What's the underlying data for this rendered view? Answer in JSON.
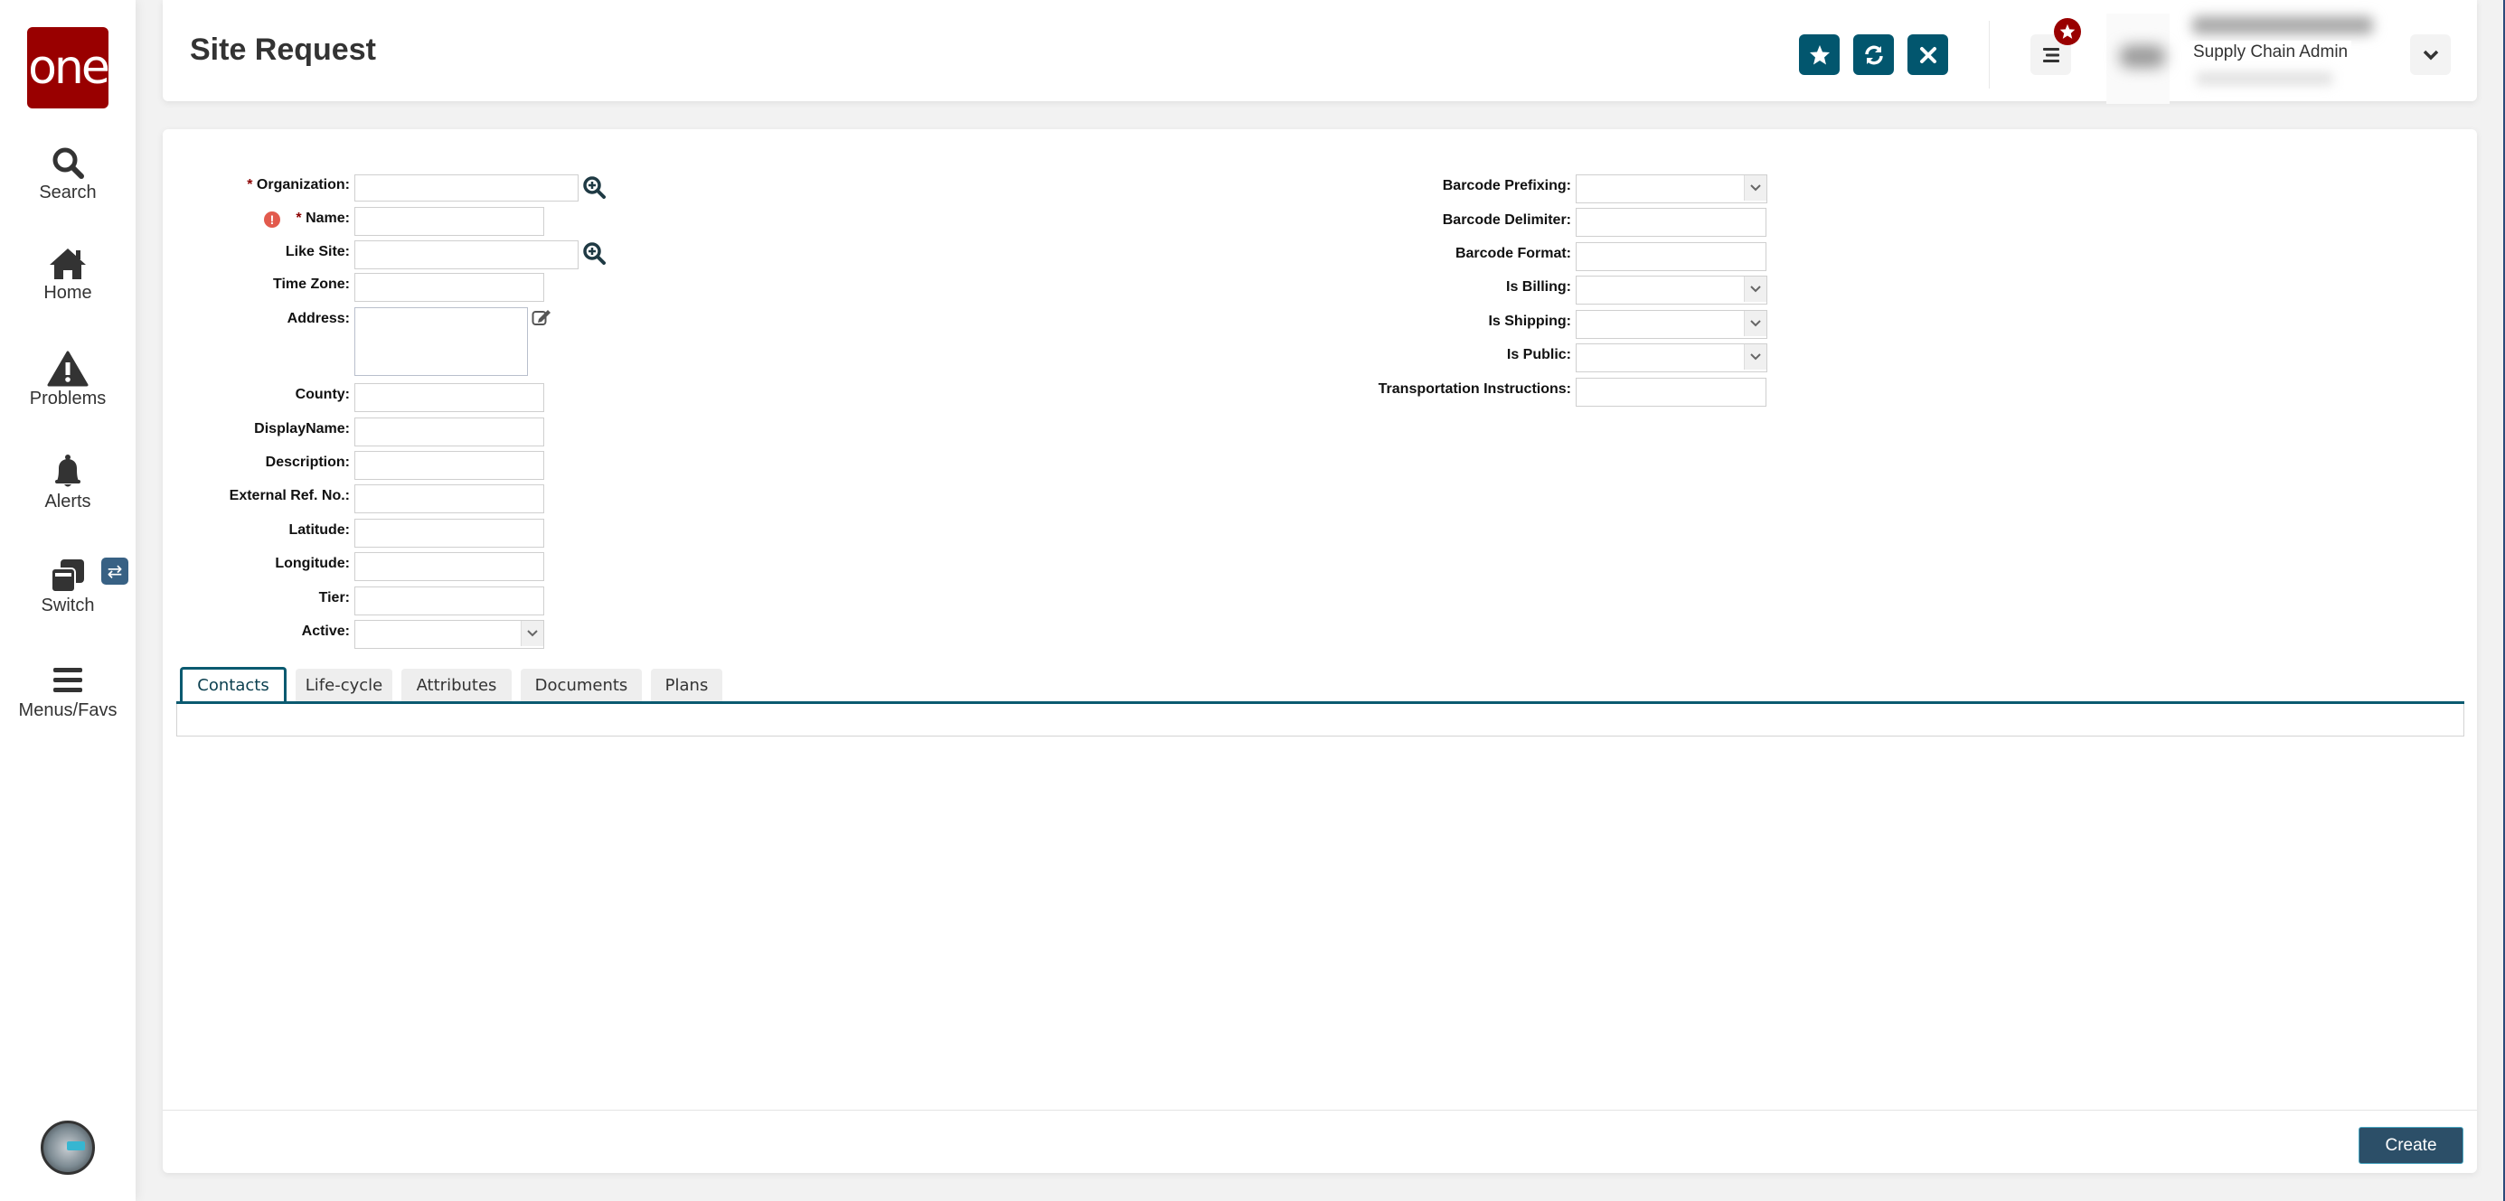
{
  "app": {
    "logo_text": "one",
    "brand_color": "#990000",
    "accent_color": "#02566e"
  },
  "sidebar": {
    "items": [
      {
        "label": "Search",
        "icon": "search-icon"
      },
      {
        "label": "Home",
        "icon": "home-icon"
      },
      {
        "label": "Problems",
        "icon": "warning-icon"
      },
      {
        "label": "Alerts",
        "icon": "bell-icon"
      },
      {
        "label": "Switch",
        "icon": "windows-icon"
      },
      {
        "label": "Menus/Favs",
        "icon": "hamburger-icon"
      }
    ],
    "switch_badge_icon": "swap-arrows-icon",
    "user_avatar": "robot-avatar"
  },
  "header": {
    "title": "Site Request",
    "buttons": [
      {
        "name": "favorite",
        "icon": "star-icon"
      },
      {
        "name": "refresh",
        "icon": "refresh-icon"
      },
      {
        "name": "close",
        "icon": "close-icon"
      }
    ],
    "menu_icon": "hamburger-icon",
    "favorites_badge_icon": "star-icon",
    "user_role": "Supply Chain Admin",
    "user_menu_icon": "chevron-down-icon"
  },
  "form": {
    "left": [
      {
        "label": "Organization:",
        "required": "*",
        "type": "lookup",
        "value": ""
      },
      {
        "label": "Name:",
        "required": "*",
        "type": "text",
        "value": "",
        "error": "!"
      },
      {
        "label": "Like Site:",
        "type": "lookup",
        "value": ""
      },
      {
        "label": "Time Zone:",
        "type": "text",
        "value": ""
      },
      {
        "label": "Address:",
        "type": "textarea",
        "value": ""
      },
      {
        "label": "County:",
        "type": "text",
        "value": ""
      },
      {
        "label": "DisplayName:",
        "type": "text",
        "value": ""
      },
      {
        "label": "Description:",
        "type": "text",
        "value": ""
      },
      {
        "label": "External Ref. No.:",
        "type": "text",
        "value": ""
      },
      {
        "label": "Latitude:",
        "type": "text",
        "value": ""
      },
      {
        "label": "Longitude:",
        "type": "text",
        "value": ""
      },
      {
        "label": "Tier:",
        "type": "text",
        "value": ""
      },
      {
        "label": "Active:",
        "type": "select",
        "value": ""
      }
    ],
    "right": [
      {
        "label": "Barcode Prefixing:",
        "type": "select",
        "value": ""
      },
      {
        "label": "Barcode Delimiter:",
        "type": "text",
        "value": ""
      },
      {
        "label": "Barcode Format:",
        "type": "text",
        "value": ""
      },
      {
        "label": "Is Billing:",
        "type": "select",
        "value": ""
      },
      {
        "label": "Is Shipping:",
        "type": "select",
        "value": ""
      },
      {
        "label": "Is Public:",
        "type": "select",
        "value": ""
      },
      {
        "label": "Transportation Instructions:",
        "type": "text",
        "value": ""
      }
    ]
  },
  "tabs": [
    {
      "label": "Contacts",
      "active": true
    },
    {
      "label": "Life-cycle",
      "active": false
    },
    {
      "label": "Attributes",
      "active": false
    },
    {
      "label": "Documents",
      "active": false
    },
    {
      "label": "Plans",
      "active": false
    }
  ],
  "footer": {
    "create_label": "Create"
  }
}
